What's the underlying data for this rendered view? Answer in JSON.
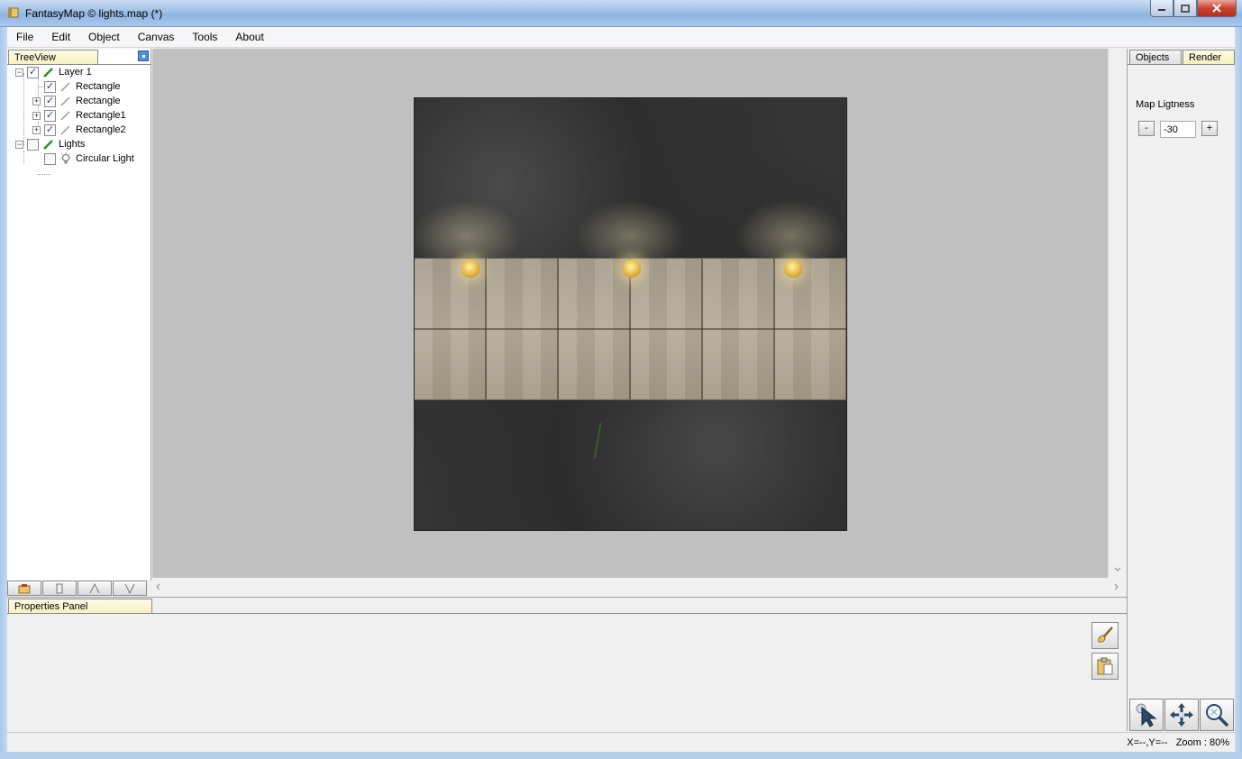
{
  "window": {
    "title": "FantasyMap © lights.map (*)"
  },
  "menu": [
    "File",
    "Edit",
    "Object",
    "Canvas",
    "Tools",
    "About"
  ],
  "treeview": {
    "tab_label": "TreeView",
    "items": [
      {
        "label": "Layer 1",
        "checked": true,
        "level": 0
      },
      {
        "label": "Rectangle",
        "checked": true,
        "level": 1
      },
      {
        "label": "Rectangle",
        "checked": true,
        "level": 1
      },
      {
        "label": "Rectangle1",
        "checked": true,
        "level": 1
      },
      {
        "label": "Rectangle2",
        "checked": true,
        "level": 1
      },
      {
        "label": "Lights",
        "checked": false,
        "level": 0
      },
      {
        "label": "Circular Light",
        "checked": false,
        "level": 1
      }
    ]
  },
  "right_panel": {
    "tabs": [
      "Objects",
      "Render"
    ],
    "active_tab": "Render",
    "map_lightness_label": "Map Ligtness",
    "minus_label": "-",
    "plus_label": "+",
    "map_lightness_value": "-30"
  },
  "properties": {
    "tab_label": "Properties Panel"
  },
  "status": {
    "coords": "X=--,Y=--",
    "zoom": "Zoom : 80%"
  },
  "icons": {
    "app": "map-scroll-icon",
    "layer": "pencil-green-icon",
    "object": "pencil-gray-icon",
    "light": "light-bulb-icon",
    "tree_tools": [
      "add-layer-icon",
      "delete-icon",
      "move-up-icon",
      "move-down-icon"
    ],
    "tools": [
      "select-pointer-icon",
      "pan-move-icon",
      "zoom-magnifier-icon"
    ],
    "props_tools": [
      "brush-icon",
      "paste-icon"
    ]
  }
}
